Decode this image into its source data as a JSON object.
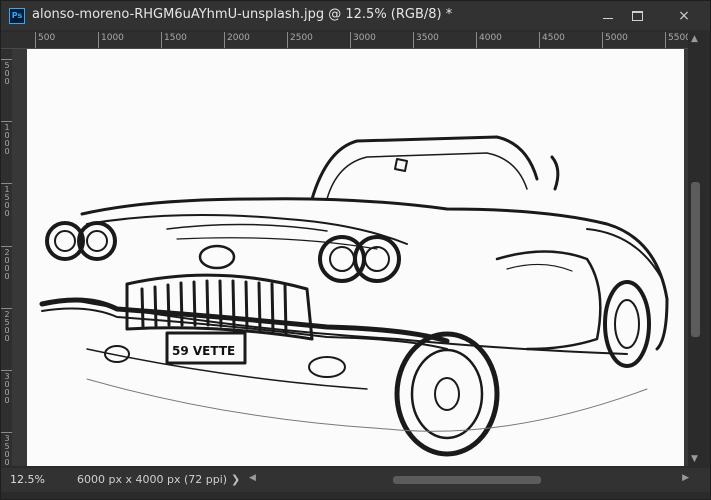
{
  "app": {
    "icon_label": "Ps"
  },
  "document": {
    "title": "alonso-moreno-RHGM6uAYhmU-unsplash.jpg @ 12.5% (RGB/8) *"
  },
  "window_controls": {
    "minimize": "minimize-icon",
    "maximize": "maximize-icon",
    "close": "×"
  },
  "ruler_top": {
    "labels": [
      "500",
      "1000",
      "1500",
      "2000",
      "2500",
      "3000",
      "3500",
      "4000",
      "4500",
      "5000",
      "5500"
    ]
  },
  "ruler_left": {
    "labels": [
      "500",
      "1000",
      "1500",
      "2000",
      "2500",
      "3000",
      "3500"
    ]
  },
  "status": {
    "zoom": "12.5%",
    "doc_info": "6000 px x 4000 px (72 ppi)",
    "arrow": "❯"
  },
  "scroll": {
    "up": "▲",
    "down": "▼",
    "left": "◀",
    "right": "▶"
  },
  "image": {
    "subject": "pencil sketch of a classic convertible car"
  }
}
